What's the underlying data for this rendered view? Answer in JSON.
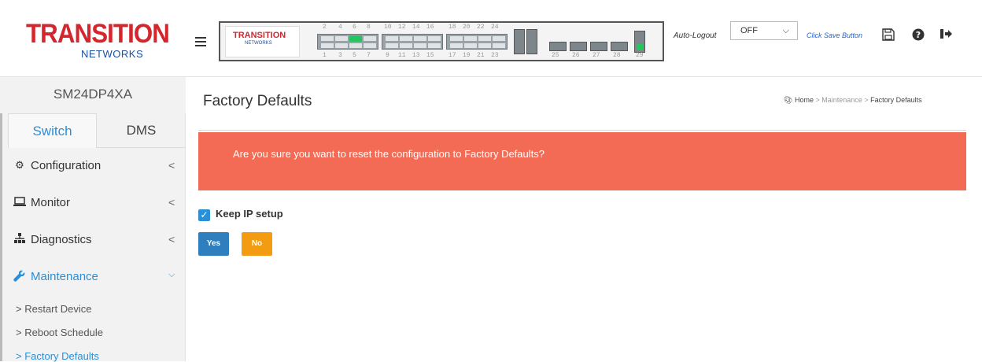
{
  "brand": {
    "logo_main": "TRANSITION",
    "logo_sub": "NETWORKS",
    "panel_logo_main": "TRANSITION",
    "panel_logo_sub": "NETWORKS"
  },
  "device": {
    "name": "SM24DP4XA"
  },
  "tabs": [
    {
      "label": "Switch",
      "active": true
    },
    {
      "label": "DMS",
      "active": false
    }
  ],
  "sidebar": {
    "items": [
      {
        "label": "Configuration",
        "icon": "gear-icon",
        "chevron": "<"
      },
      {
        "label": "Monitor",
        "icon": "laptop-icon",
        "chevron": "<"
      },
      {
        "label": "Diagnostics",
        "icon": "sitemap-icon",
        "chevron": "<"
      },
      {
        "label": "Maintenance",
        "icon": "wrench-icon",
        "chevron": "v",
        "active": true
      }
    ],
    "submenu": [
      {
        "label": "Restart Device"
      },
      {
        "label": "Reboot Schedule"
      },
      {
        "label": "Factory Defaults",
        "active": true
      }
    ]
  },
  "port_panel": {
    "top_numbers": [
      "2",
      "4",
      "6",
      "8",
      "10",
      "12",
      "14",
      "16",
      "18",
      "20",
      "22",
      "24"
    ],
    "bottom_numbers": [
      "1",
      "3",
      "5",
      "7",
      "9",
      "11",
      "13",
      "15",
      "17",
      "19",
      "21",
      "23",
      "25",
      "26",
      "27",
      "28",
      "29"
    ]
  },
  "header": {
    "auto_logout_label": "Auto-Logout",
    "auto_logout_value": "OFF",
    "save_hint": "Click Save Button"
  },
  "page": {
    "title": "Factory Defaults",
    "breadcrumb": {
      "home": "Home",
      "sep": ">",
      "section": "Maintenance",
      "current": "Factory Defaults"
    },
    "alert": "Are you sure you want to reset the configuration to Factory Defaults?",
    "keep_ip_label": "Keep IP setup",
    "keep_ip_checked": true,
    "yes_label": "Yes",
    "no_label": "No"
  },
  "colors": {
    "accent": "#2a8fd6",
    "alert": "#f36b55",
    "yes": "#2f7fbf",
    "no": "#f39c12",
    "brand_red": "#d3262d",
    "brand_blue": "#1c4f9c"
  }
}
